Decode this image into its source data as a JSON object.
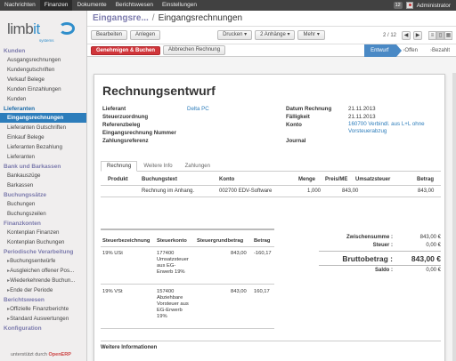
{
  "topbar": {
    "menus": [
      "Nachrichten",
      "Finanzen",
      "Dokumente",
      "Berichtswesen",
      "Einstellungen"
    ],
    "badge": "12",
    "user": "Administrator"
  },
  "sidebar": {
    "logo_main": "limb",
    "logo_it": "it",
    "logo_sub": "systems",
    "sections": [
      {
        "title": "Kunden",
        "items": [
          "Ausgangsrechnungen",
          "Kundengutschriften",
          "Verkauf Belege",
          "Kunden Einzahlungen",
          "Kunden"
        ]
      },
      {
        "title": "Lieferanten",
        "items": [
          "Eingangsrechnungen",
          "Lieferanten Gutschriften",
          "Einkauf Belege",
          "Lieferanten Bezahlung",
          "Lieferanten"
        ]
      },
      {
        "title": "Bank und Barkassen",
        "items": [
          "Bankauszüge",
          "Barkassen"
        ]
      },
      {
        "title": "Buchungssätze",
        "items": [
          "Buchungen",
          "Buchungszeilen"
        ]
      },
      {
        "title": "Finanzkonten",
        "items": [
          "Kontenplan Finanzen",
          "Kontenplan Buchungen"
        ]
      },
      {
        "title": "Periodische Verarbeitung",
        "items": [
          "Buchungsentwürfe",
          "Ausgleichen offener Pos...",
          "Wiederkehrende Buchun...",
          "Ende der Periode"
        ]
      },
      {
        "title": "Berichtswesen",
        "items": [
          "Offizielle Finanzberichte",
          "Standard Auswertungen"
        ]
      },
      {
        "title": "Konfiguration",
        "items": []
      }
    ],
    "footer_text": "unterstützt durch",
    "footer_brand": "OpenERP"
  },
  "header": {
    "crumb_parent": "Eingangsre...",
    "crumb_sep": "/",
    "crumb_current": "Eingangsrechnungen"
  },
  "toolbar": {
    "edit": "Bearbeiten",
    "create": "Anlegen",
    "print": "Drucken",
    "attachments": "2 Anhänge",
    "more": "Mehr",
    "pager": "2 / 12",
    "prev": "◀",
    "next": "▶"
  },
  "status": {
    "approve": "Genehmigen & Buchen",
    "cancel": "Abbrechen Rechnung",
    "stages": [
      "Entwurf",
      "Offen",
      "Bezahlt"
    ]
  },
  "form": {
    "title": "Rechnungsentwurf",
    "left": [
      {
        "label": "Lieferant",
        "value": "Delta PC"
      },
      {
        "label": "Steuerzuordnung",
        "value": ""
      },
      {
        "label": "Referenzbeleg",
        "value": ""
      },
      {
        "label": "Eingangsrechnung Nummer",
        "value": ""
      },
      {
        "label": "Zahlungsreferenz",
        "value": ""
      }
    ],
    "right": [
      {
        "label": "Datum Rechnung",
        "value": "21.11.2013"
      },
      {
        "label": "Fälligkeit",
        "value": "21.11.2013"
      },
      {
        "label": "Konto",
        "value": "160700 Verbindl. aus L+L ohne Vorsteuerabzug"
      },
      {
        "label": "Journal",
        "value": ""
      }
    ]
  },
  "tabs": [
    "Rechnung",
    "Weitere Info",
    "Zahlungen"
  ],
  "lines": {
    "headers": [
      "Produkt",
      "Buchungstext",
      "Konto",
      "Menge",
      "Preis/ME",
      "Umsatzsteuer",
      "Betrag"
    ],
    "rows": [
      {
        "product": "",
        "text": "Rechnung im Anhang.",
        "account": "002700 EDV-Software",
        "qty": "1,000",
        "price": "843,00",
        "tax": "",
        "amount": "843,00"
      }
    ]
  },
  "taxes": {
    "headers": [
      "Steuerbezeichnung",
      "Steuerkonto",
      "Steuergrundbetrag",
      "Betrag"
    ],
    "rows": [
      {
        "name": "19% USt",
        "account": "177400 Umsatzsteuer aus EG-Erwerb 19%",
        "base": "843,00",
        "amount": "-160,17"
      },
      {
        "name": "19% VSt",
        "account": "157400 Abziehbare Vorsteuer aus EG-Erwerb 19%",
        "base": "843,00",
        "amount": "160,17"
      }
    ]
  },
  "totals": {
    "subtotal_label": "Zwischensumme :",
    "subtotal": "843,00 €",
    "tax_label": "Steuer :",
    "tax": "0,00 €",
    "gross_label": "Bruttobetrag :",
    "gross": "843,00 €",
    "balance_label": "Saldo :",
    "balance": "0,00 €"
  },
  "notes_label": "Weitere Informationen",
  "colors": {
    "accent": "#2d7dbb",
    "danger": "#d0353a",
    "section": "#7c7bad"
  }
}
